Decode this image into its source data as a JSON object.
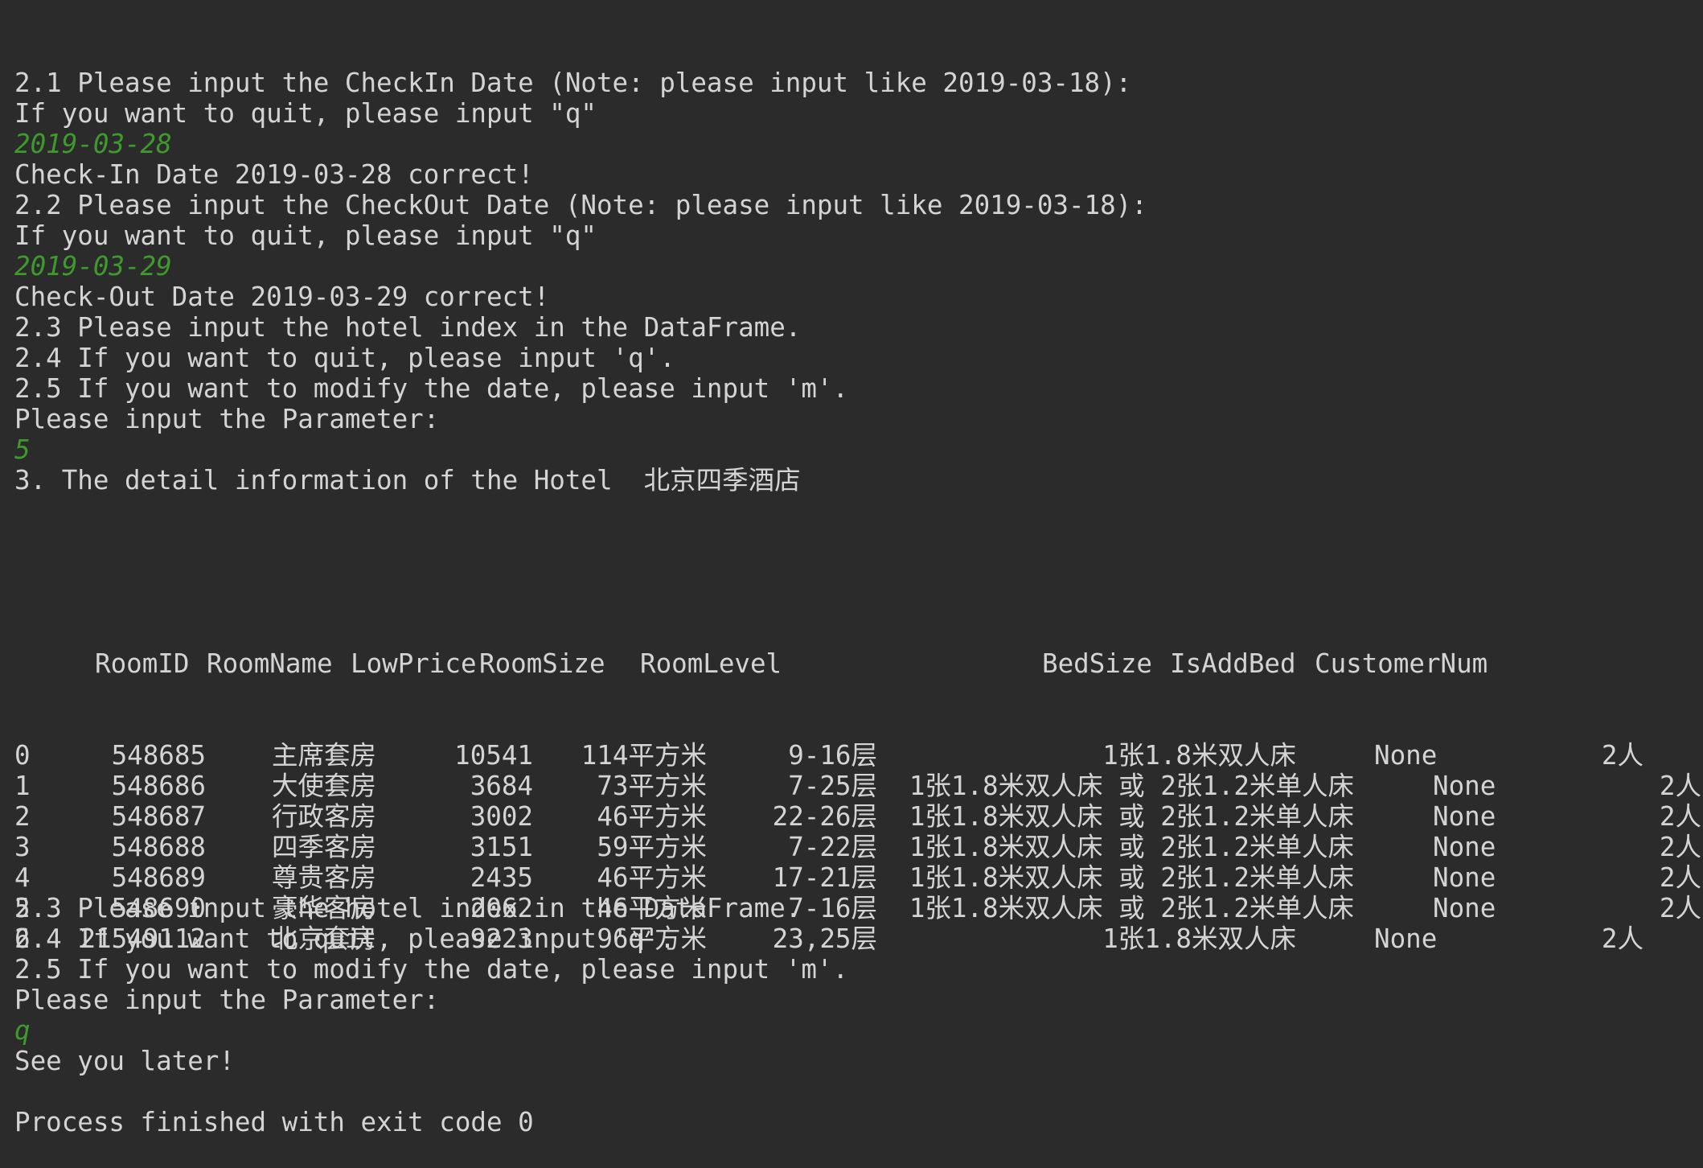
{
  "console": {
    "part1": [
      {
        "text": "2.1 Please input the CheckIn Date (Note: please input like 2019-03-18):",
        "type": "output"
      },
      {
        "text": "If you want to quit, please input \"q\"",
        "type": "output"
      },
      {
        "text": "2019-03-28",
        "type": "input"
      },
      {
        "text": "Check-In Date 2019-03-28 correct!",
        "type": "output"
      },
      {
        "text": "2.2 Please input the CheckOut Date (Note: please input like 2019-03-18):",
        "type": "output"
      },
      {
        "text": "If you want to quit, please input \"q\"",
        "type": "output"
      },
      {
        "text": "2019-03-29",
        "type": "input"
      },
      {
        "text": "Check-Out Date 2019-03-29 correct!",
        "type": "output"
      },
      {
        "text": "2.3 Please input the hotel index in the DataFrame.",
        "type": "output"
      },
      {
        "text": "2.4 If you want to quit, please input 'q'.",
        "type": "output"
      },
      {
        "text": "2.5 If you want to modify the date, please input 'm'.",
        "type": "output"
      },
      {
        "text": "Please input the Parameter:",
        "type": "output"
      },
      {
        "text": "5",
        "type": "input"
      },
      {
        "text": "3. The detail information of the Hotel  北京四季酒店",
        "type": "output"
      }
    ],
    "table": {
      "headers": [
        "RoomID",
        "RoomName",
        "LowPrice",
        "RoomSize",
        "RoomLevel",
        "BedSize",
        "IsAddBed",
        "CustomerNum"
      ],
      "rows": [
        {
          "index": "0",
          "RoomID": "548685",
          "RoomName": "主席套房",
          "LowPrice": "10541",
          "RoomSize": "114平方米",
          "RoomLevel": "9-16层",
          "BedSize": "1张1.8米双人床",
          "IsAddBed": "None",
          "CustomerNum": "2人",
          "short": true
        },
        {
          "index": "1",
          "RoomID": "548686",
          "RoomName": "大使套房",
          "LowPrice": "3684",
          "RoomSize": "73平方米",
          "RoomLevel": "7-25层",
          "BedSize": "1张1.8米双人床 或 2张1.2米单人床",
          "IsAddBed": "None",
          "CustomerNum": "2人",
          "short": false
        },
        {
          "index": "2",
          "RoomID": "548687",
          "RoomName": "行政客房",
          "LowPrice": "3002",
          "RoomSize": "46平方米",
          "RoomLevel": "22-26层",
          "BedSize": "1张1.8米双人床 或 2张1.2米单人床",
          "IsAddBed": "None",
          "CustomerNum": "2人",
          "short": false
        },
        {
          "index": "3",
          "RoomID": "548688",
          "RoomName": "四季客房",
          "LowPrice": "3151",
          "RoomSize": "59平方米",
          "RoomLevel": "7-22层",
          "BedSize": "1张1.8米双人床 或 2张1.2米单人床",
          "IsAddBed": "None",
          "CustomerNum": "2人",
          "short": false
        },
        {
          "index": "4",
          "RoomID": "548689",
          "RoomName": "尊贵客房",
          "LowPrice": "2435",
          "RoomSize": "46平方米",
          "RoomLevel": "17-21层",
          "BedSize": "1张1.8米双人床 或 2张1.2米单人床",
          "IsAddBed": "None",
          "CustomerNum": "2人",
          "short": false
        },
        {
          "index": "5",
          "RoomID": "548690",
          "RoomName": "豪华客房",
          "LowPrice": "2062",
          "RoomSize": "46平方米",
          "RoomLevel": "7-16层",
          "BedSize": "1张1.8米双人床 或 2张1.2米单人床",
          "IsAddBed": "None",
          "CustomerNum": "2人",
          "short": false
        },
        {
          "index": "6",
          "RoomID": "21549112",
          "RoomName": "北京套房",
          "LowPrice": "9223",
          "RoomSize": "96平方米",
          "RoomLevel": "23,25层",
          "BedSize": "1张1.8米双人床",
          "IsAddBed": "None",
          "CustomerNum": "2人",
          "short": true
        }
      ]
    },
    "part2": [
      {
        "text": "2.3 Please input the hotel index in the DataFrame.",
        "type": "output"
      },
      {
        "text": "2.4 If you want to quit, please input 'q'.",
        "type": "output"
      },
      {
        "text": "2.5 If you want to modify the date, please input 'm'.",
        "type": "output"
      },
      {
        "text": "Please input the Parameter:",
        "type": "output"
      },
      {
        "text": "q",
        "type": "input"
      },
      {
        "text": "See you later!",
        "type": "output"
      },
      {
        "text": "",
        "type": "blank"
      },
      {
        "text": "Process finished with exit code 0",
        "type": "output"
      }
    ]
  },
  "colors": {
    "background": "#2b2b2b",
    "output_text": "#d4d4d4",
    "input_text": "#3e9a2c"
  }
}
